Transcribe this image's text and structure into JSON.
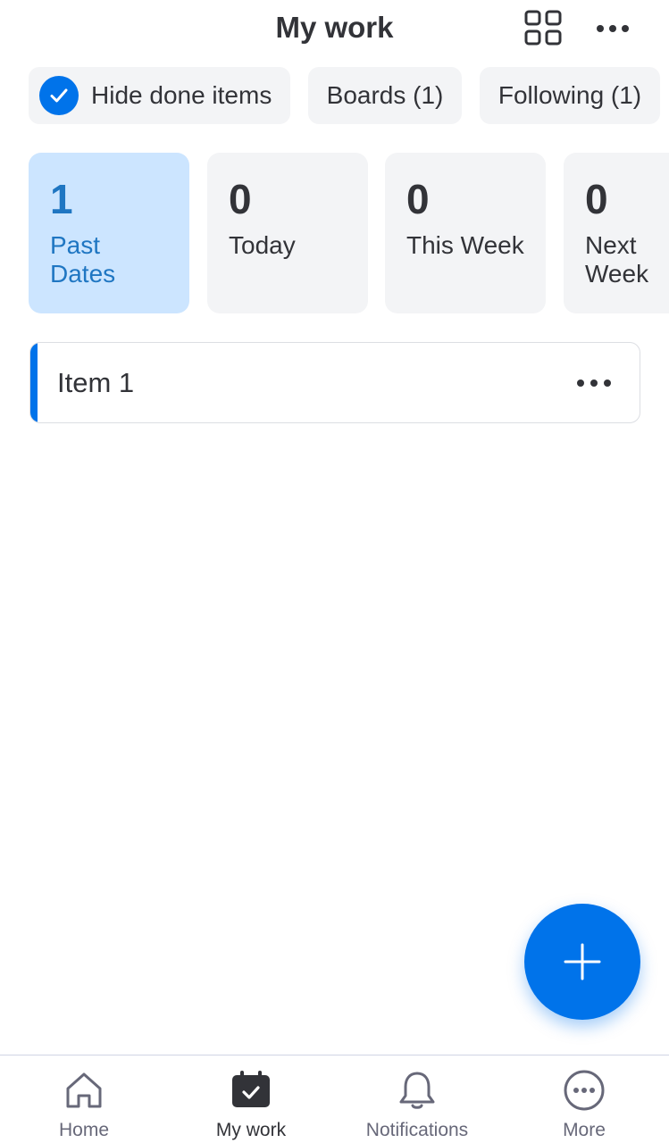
{
  "header": {
    "title": "My work",
    "icons": [
      "grid-view-icon",
      "more-horizontal-icon"
    ]
  },
  "filters": {
    "hide_done": {
      "label": "Hide done items",
      "checked": true
    },
    "boards": {
      "label": "Boards (1)"
    },
    "following": {
      "label": "Following (1)"
    }
  },
  "date_cards": [
    {
      "count": "1",
      "label": "Past Dates",
      "active": true
    },
    {
      "count": "0",
      "label": "Today",
      "active": false
    },
    {
      "count": "0",
      "label": "This Week",
      "active": false
    },
    {
      "count": "0",
      "label": "Next Week",
      "active": false
    }
  ],
  "items": [
    {
      "name": "Item 1",
      "accent_color": "#0073ea"
    }
  ],
  "fab": {
    "icon": "plus-icon"
  },
  "bottom_nav": {
    "items": [
      {
        "label": "Home",
        "icon": "home-icon",
        "active": false
      },
      {
        "label": "My work",
        "icon": "calendar-check-icon",
        "active": true
      },
      {
        "label": "Notifications",
        "icon": "bell-icon",
        "active": false
      },
      {
        "label": "More",
        "icon": "more-circle-icon",
        "active": false
      }
    ]
  },
  "colors": {
    "accent": "#0073ea",
    "active_card_bg": "#cce5ff",
    "active_card_text": "#1f76c2",
    "chip_bg": "#f3f4f6",
    "text_primary": "#323338",
    "text_secondary": "#676879"
  }
}
